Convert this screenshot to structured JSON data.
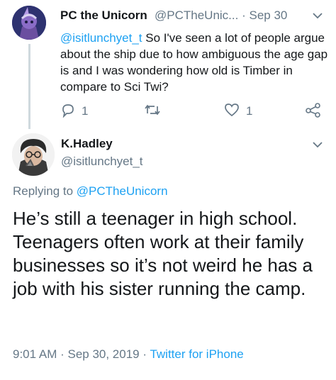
{
  "parent_tweet": {
    "display_name": "PC the Unicorn",
    "handle": "@PCTheUnic...",
    "separator": "·",
    "date": "Sep 30",
    "reply_mention": "@isitlunchyet_t",
    "text": " So I've seen a lot of people argue about the ship due to how ambiguous the age gap is and I was wondering how old is Timber in compare to Sci Twi?",
    "reply_count": "1",
    "retweet_count": "",
    "like_count": "1"
  },
  "main_tweet": {
    "display_name": "K.Hadley",
    "handle": "@isitlunchyet_t",
    "replying_prefix": "Replying to ",
    "replying_to": "@PCTheUnicorn",
    "text": "He’s still a teenager in high school. Teenagers often work at their family businesses so it’s not weird he has a job with his sister running the camp.",
    "time": "9:01 AM",
    "separator": " · ",
    "date": "Sep 30, 2019",
    "source": "Twitter for iPhone"
  },
  "colors": {
    "accent": "#1da1f2",
    "secondary_text": "#657786",
    "primary_text": "#14171a",
    "thread_line": "#cfd9de"
  },
  "icons": [
    "reply-icon",
    "retweet-icon",
    "like-icon",
    "share-icon",
    "chevron-down-icon"
  ]
}
